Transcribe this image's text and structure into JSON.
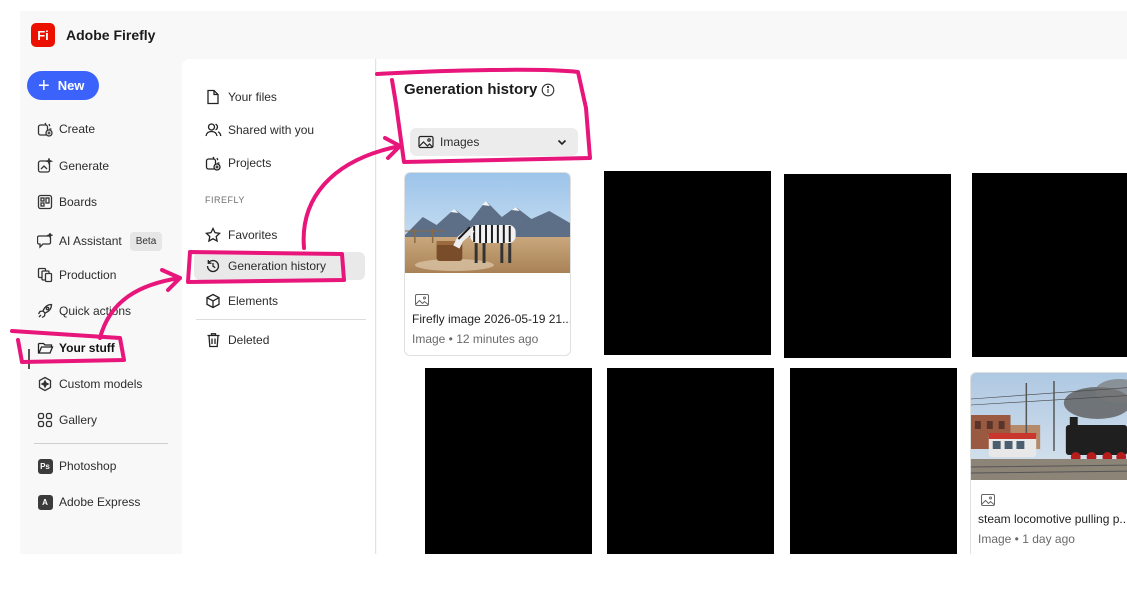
{
  "app": {
    "logo_text": "Fi",
    "title": "Adobe Firefly"
  },
  "rail": {
    "new_label": "New",
    "items": [
      {
        "label": "Create",
        "icon": "create-icon"
      },
      {
        "label": "Generate",
        "icon": "generate-icon"
      },
      {
        "label": "Boards",
        "icon": "boards-icon"
      },
      {
        "label": "AI Assistant",
        "icon": "ai-assistant-icon",
        "badge": "Beta"
      },
      {
        "label": "Production",
        "icon": "production-icon"
      },
      {
        "label": "Quick actions",
        "icon": "rocket-icon"
      },
      {
        "label": "Your stuff",
        "icon": "folder-icon",
        "active": true
      },
      {
        "label": "Custom models",
        "icon": "custom-models-icon"
      },
      {
        "label": "Gallery",
        "icon": "gallery-icon"
      }
    ],
    "apps": [
      {
        "label": "Photoshop",
        "badge": "Ps"
      },
      {
        "label": "Adobe Express",
        "badge": "A"
      }
    ]
  },
  "files_panel": {
    "items": [
      {
        "label": "Your files",
        "icon": "file-icon"
      },
      {
        "label": "Shared with you",
        "icon": "shared-users-icon"
      },
      {
        "label": "Projects",
        "icon": "projects-icon"
      }
    ],
    "section_label": "FIREFLY",
    "firefly_items": [
      {
        "label": "Favorites",
        "icon": "star-icon"
      },
      {
        "label": "Generation history",
        "icon": "history-icon",
        "selected": true
      },
      {
        "label": "Elements",
        "icon": "cube-icon"
      }
    ],
    "deleted_label": "Deleted"
  },
  "main": {
    "title": "Generation history",
    "filter": {
      "value": "Images"
    },
    "cards": [
      {
        "title": "Firefly image 2026-05-19 21...",
        "meta": "Image • 12 minutes ago"
      },
      {
        "title": "steam locomotive pulling p...",
        "meta": "Image • 1 day ago"
      }
    ]
  },
  "colors": {
    "brand": "#eb1000",
    "accent": "#3b63fb",
    "annotation": "#e8157a",
    "tile": "#000000"
  }
}
